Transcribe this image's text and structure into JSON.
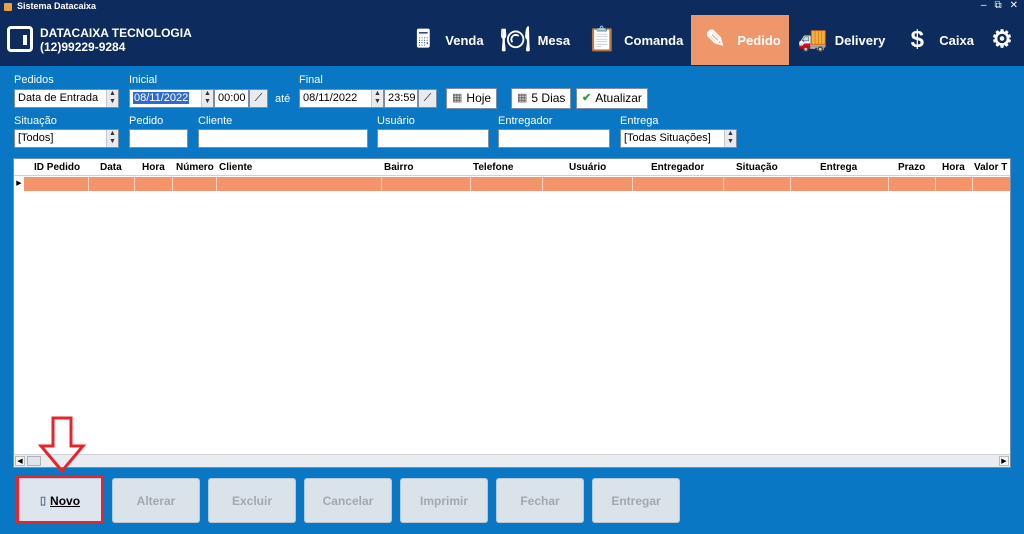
{
  "window": {
    "title": "Sistema Datacaixa",
    "controls": [
      "–",
      "⧉",
      "✕"
    ]
  },
  "company": {
    "name": "DATACAIXA TECNOLOGIA",
    "phone": "(12)99229-9284"
  },
  "nav": [
    {
      "label": "Venda",
      "icon": "cash-register-icon",
      "glyph": "🖩"
    },
    {
      "label": "Mesa",
      "icon": "table-dining-icon",
      "glyph": "🍽"
    },
    {
      "label": "Comanda",
      "icon": "order-list-icon",
      "glyph": "📋"
    },
    {
      "label": "Pedido",
      "icon": "pedido-edit-icon",
      "glyph": "✎"
    },
    {
      "label": "Delivery",
      "icon": "delivery-truck-icon",
      "glyph": "🚚"
    },
    {
      "label": "Caixa",
      "icon": "dollar-icon",
      "glyph": "$"
    },
    {
      "label": "",
      "icon": "gears-icon",
      "glyph": "⚙"
    }
  ],
  "active_nav": "Pedido",
  "accent": "#f0966b",
  "filters": {
    "pedidos_label": "Pedidos",
    "pedidos_value": "Data de Entrada",
    "inicial_label": "Inicial",
    "inicial_date": "08/11/2022",
    "inicial_time": "00:00",
    "ate": "até",
    "final_label": "Final",
    "final_date": "08/11/2022",
    "final_time": "23:59",
    "hoje": "Hoje",
    "cinco_dias": "5 Dias",
    "atualizar": "Atualizar",
    "situacao_label": "Situação",
    "situacao_value": "[Todos]",
    "pedido_label": "Pedido",
    "pedido_value": "",
    "cliente_label": "Cliente",
    "cliente_value": "",
    "usuario_label": "Usuário",
    "usuario_value": "",
    "entregador_label": "Entregador",
    "entregador_value": "",
    "entrega_label": "Entrega",
    "entrega_value": "[Todas Situações]"
  },
  "grid": {
    "columns": [
      "ID Pedido",
      "Data",
      "Hora",
      "Número",
      "Cliente",
      "Bairro",
      "Telefone",
      "Usuário",
      "Entregador",
      "Situação",
      "Entrega",
      "Prazo",
      "Hora",
      "Valor T"
    ]
  },
  "buttons": [
    "Novo",
    "Alterar",
    "Excluir",
    "Cancelar",
    "Imprimir",
    "Fechar",
    "Entregar"
  ],
  "button_mnemonics": [
    "N",
    "A",
    "E",
    "C",
    "I",
    "F",
    "E"
  ]
}
